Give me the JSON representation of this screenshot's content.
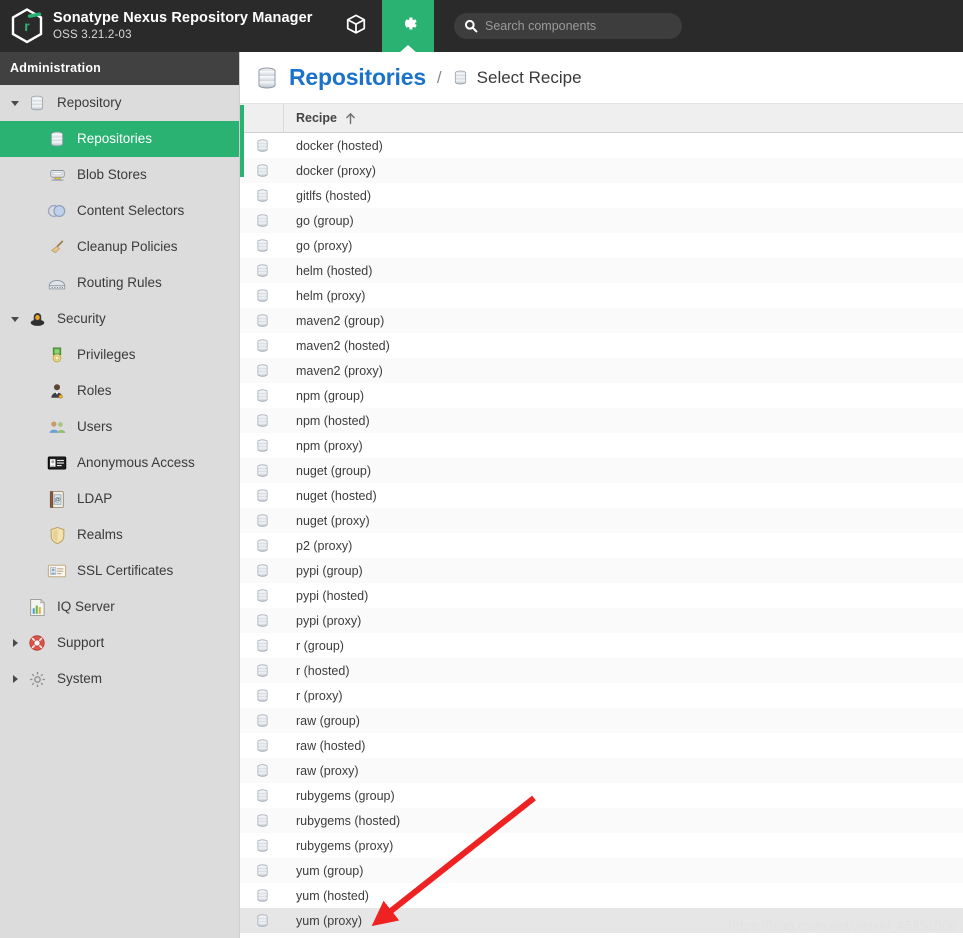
{
  "header": {
    "brand_title": "Sonatype Nexus Repository Manager",
    "brand_version": "OSS 3.21.2-03",
    "logo_icon": "nexus-hexagon-logo",
    "tabs": [
      {
        "name": "browse",
        "icon": "cube-icon",
        "active": false
      },
      {
        "name": "administration",
        "icon": "gear-icon",
        "active": true
      }
    ],
    "search": {
      "placeholder": "Search components",
      "value": "",
      "icon": "search-icon"
    }
  },
  "sidebar": {
    "title": "Administration",
    "items": [
      {
        "label": "Repository",
        "icon": "database-icon",
        "level": "group",
        "caret": "down",
        "selected": false
      },
      {
        "label": "Repositories",
        "icon": "database-stack-icon",
        "level": "child",
        "caret": "",
        "selected": true
      },
      {
        "label": "Blob Stores",
        "icon": "blob-store-icon",
        "level": "child",
        "caret": "",
        "selected": false
      },
      {
        "label": "Content Selectors",
        "icon": "content-selector-icon",
        "level": "child",
        "caret": "",
        "selected": false
      },
      {
        "label": "Cleanup Policies",
        "icon": "broom-icon",
        "level": "child",
        "caret": "",
        "selected": false
      },
      {
        "label": "Routing Rules",
        "icon": "routing-rules-icon",
        "level": "child",
        "caret": "",
        "selected": false
      },
      {
        "label": "Security",
        "icon": "security-shield-icon",
        "level": "group",
        "caret": "down",
        "selected": false
      },
      {
        "label": "Privileges",
        "icon": "privileges-icon",
        "level": "child",
        "caret": "",
        "selected": false
      },
      {
        "label": "Roles",
        "icon": "roles-icon",
        "level": "child",
        "caret": "",
        "selected": false
      },
      {
        "label": "Users",
        "icon": "users-icon",
        "level": "child",
        "caret": "",
        "selected": false
      },
      {
        "label": "Anonymous Access",
        "icon": "id-card-icon",
        "level": "child",
        "caret": "",
        "selected": false
      },
      {
        "label": "LDAP",
        "icon": "ldap-book-icon",
        "level": "child",
        "caret": "",
        "selected": false
      },
      {
        "label": "Realms",
        "icon": "realms-shield-icon",
        "level": "child",
        "caret": "",
        "selected": false
      },
      {
        "label": "SSL Certificates",
        "icon": "certificate-icon",
        "level": "child",
        "caret": "",
        "selected": false
      },
      {
        "label": "IQ Server",
        "icon": "iq-server-icon",
        "level": "sub",
        "caret": "",
        "selected": false
      },
      {
        "label": "Support",
        "icon": "lifebuoy-icon",
        "level": "group",
        "caret": "right",
        "selected": false
      },
      {
        "label": "System",
        "icon": "system-gear-icon",
        "level": "group",
        "caret": "right",
        "selected": false
      }
    ]
  },
  "content": {
    "breadcrumb": {
      "primary_label": "Repositories",
      "primary_icon": "database-stack-icon",
      "separator": "/",
      "secondary_label": "Select Recipe",
      "secondary_icon": "database-icon"
    },
    "table": {
      "columns": [
        {
          "key": "icon",
          "label": ""
        },
        {
          "key": "recipe",
          "label": "Recipe",
          "sort": "asc",
          "sort_icon": "arrow-up-icon"
        }
      ],
      "row_icon": "database-icon",
      "rows": [
        {
          "recipe": "docker (hosted)",
          "hovered": false
        },
        {
          "recipe": "docker (proxy)",
          "hovered": false
        },
        {
          "recipe": "gitlfs (hosted)",
          "hovered": false
        },
        {
          "recipe": "go (group)",
          "hovered": false
        },
        {
          "recipe": "go (proxy)",
          "hovered": false
        },
        {
          "recipe": "helm (hosted)",
          "hovered": false
        },
        {
          "recipe": "helm (proxy)",
          "hovered": false
        },
        {
          "recipe": "maven2 (group)",
          "hovered": false
        },
        {
          "recipe": "maven2 (hosted)",
          "hovered": false
        },
        {
          "recipe": "maven2 (proxy)",
          "hovered": false
        },
        {
          "recipe": "npm (group)",
          "hovered": false
        },
        {
          "recipe": "npm (hosted)",
          "hovered": false
        },
        {
          "recipe": "npm (proxy)",
          "hovered": false
        },
        {
          "recipe": "nuget (group)",
          "hovered": false
        },
        {
          "recipe": "nuget (hosted)",
          "hovered": false
        },
        {
          "recipe": "nuget (proxy)",
          "hovered": false
        },
        {
          "recipe": "p2 (proxy)",
          "hovered": false
        },
        {
          "recipe": "pypi (group)",
          "hovered": false
        },
        {
          "recipe": "pypi (hosted)",
          "hovered": false
        },
        {
          "recipe": "pypi (proxy)",
          "hovered": false
        },
        {
          "recipe": "r (group)",
          "hovered": false
        },
        {
          "recipe": "r (hosted)",
          "hovered": false
        },
        {
          "recipe": "r (proxy)",
          "hovered": false
        },
        {
          "recipe": "raw (group)",
          "hovered": false
        },
        {
          "recipe": "raw (hosted)",
          "hovered": false
        },
        {
          "recipe": "raw (proxy)",
          "hovered": false
        },
        {
          "recipe": "rubygems (group)",
          "hovered": false
        },
        {
          "recipe": "rubygems (hosted)",
          "hovered": false
        },
        {
          "recipe": "rubygems (proxy)",
          "hovered": false
        },
        {
          "recipe": "yum (group)",
          "hovered": false
        },
        {
          "recipe": "yum (hosted)",
          "hovered": false
        },
        {
          "recipe": "yum (proxy)",
          "hovered": true
        }
      ]
    }
  },
  "annotation": {
    "arrow_icon": "red-arrow-annotation",
    "color": "#ee2222",
    "points_to": "yum (proxy)"
  },
  "watermark": {
    "text": "https://blog.csdn.net/weixin_45651006"
  },
  "colors": {
    "accent_green": "#2ab273",
    "header_dark": "#2a2a2a",
    "sidebar_bg": "#dcdcdc",
    "link_blue": "#1a73c8"
  }
}
